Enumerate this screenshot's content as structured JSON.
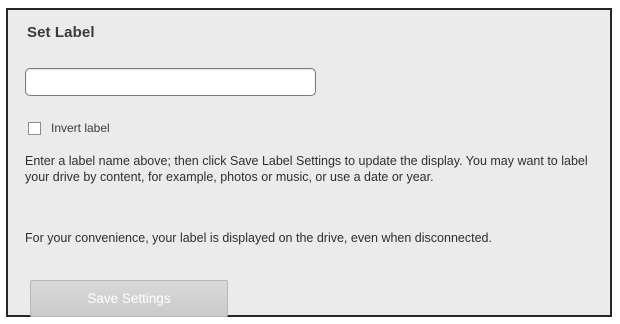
{
  "panel": {
    "title": "Set Label",
    "label_input": {
      "value": "",
      "placeholder": ""
    },
    "invert_checkbox": {
      "label": "Invert label",
      "checked": false
    },
    "help_paragraphs": [
      "Enter a label name above; then click Save Label Settings to update the display. You may want to label your drive by content, for example, photos or music, or use a date or year.",
      "For your convenience, your label is displayed on the drive, even when disconnected."
    ],
    "save_button": {
      "label": "Save Settings",
      "disabled": true
    }
  },
  "colors": {
    "panel_background": "#ebebeb",
    "panel_border": "#262626",
    "button_background": "#d0d0d0",
    "button_text": "#ffffff"
  }
}
